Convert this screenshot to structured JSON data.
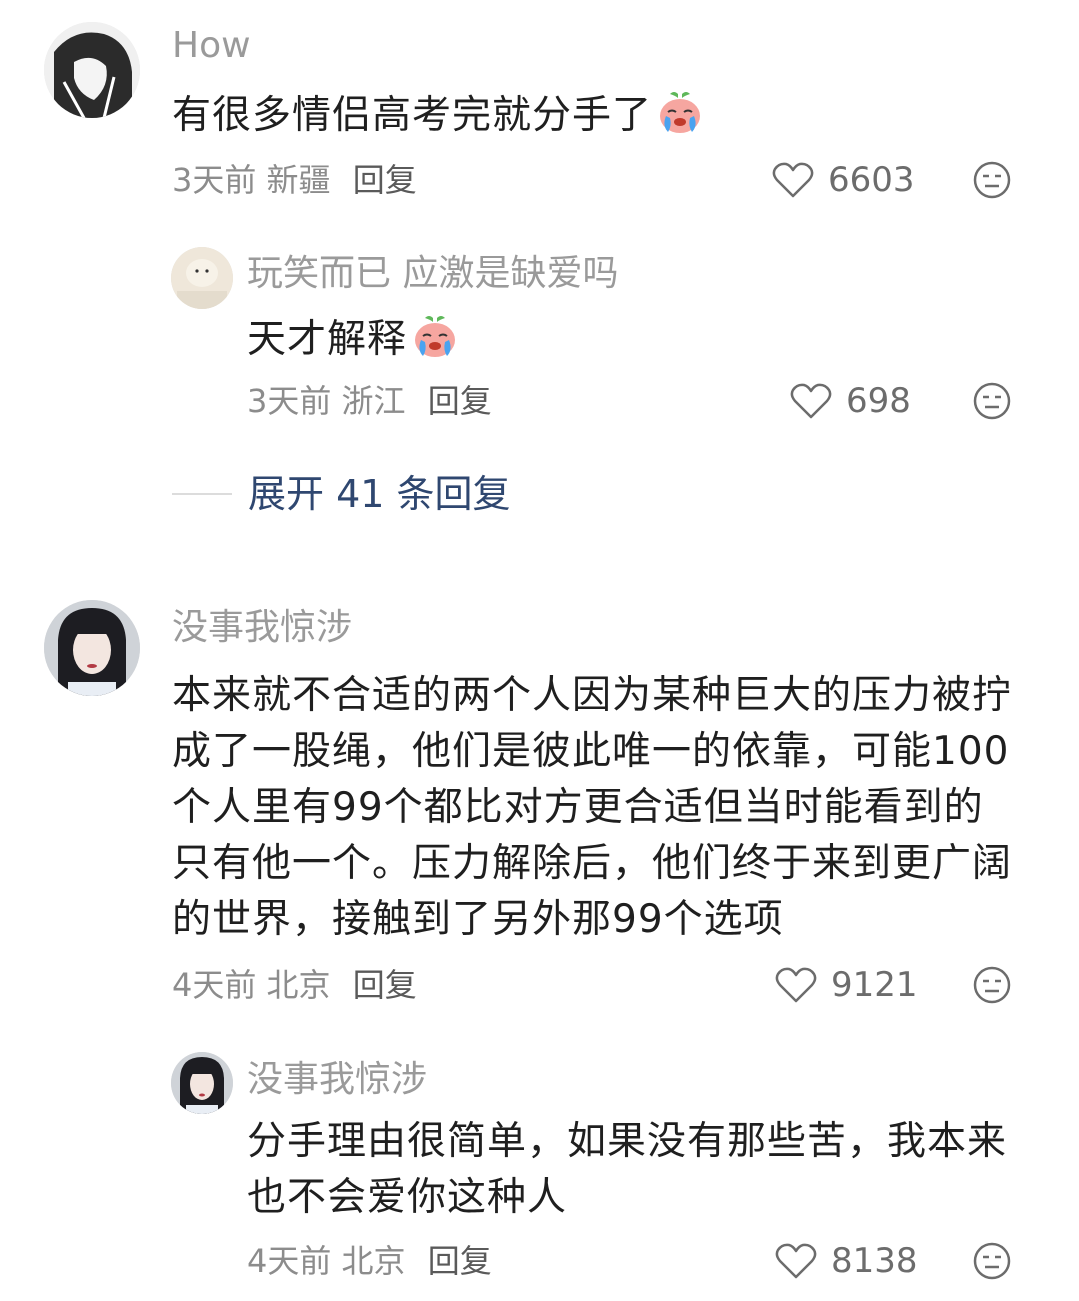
{
  "comments": [
    {
      "username": "How",
      "content": "有很多情侣高考完就分手了",
      "emoji": "crying-face-emoji",
      "time": "3天前",
      "location": "新疆",
      "reply_label": "回复",
      "likes": "6603",
      "replies": [
        {
          "username": "玩笑而已 应激是缺爱吗",
          "content": "天才解释",
          "emoji": "crying-face-emoji",
          "time": "3天前",
          "location": "浙江",
          "reply_label": "回复",
          "likes": "698"
        }
      ],
      "expand_label": "展开 41 条回复"
    },
    {
      "username": "没事我惊涉",
      "content": "本来就不合适的两个人因为某种巨大的压力被拧成了一股绳，他们是彼此唯一的依靠，可能100个人里有99个都比对方更合适但当时能看到的只有他一个。压力解除后，他们终于来到更广阔的世界，接触到了另外那99个选项",
      "time": "4天前",
      "location": "北京",
      "reply_label": "回复",
      "likes": "9121",
      "replies": [
        {
          "username": "没事我惊涉",
          "content": "分手理由很简单，如果没有那些苦，我本来也不会爱你这种人",
          "time": "4天前",
          "location": "北京",
          "reply_label": "回复",
          "likes": "8138"
        }
      ]
    }
  ],
  "colors": {
    "username": "#9a9a9a",
    "content": "#1f1f1f",
    "meta": "#8c8c8c",
    "expand": "#2f4770"
  }
}
